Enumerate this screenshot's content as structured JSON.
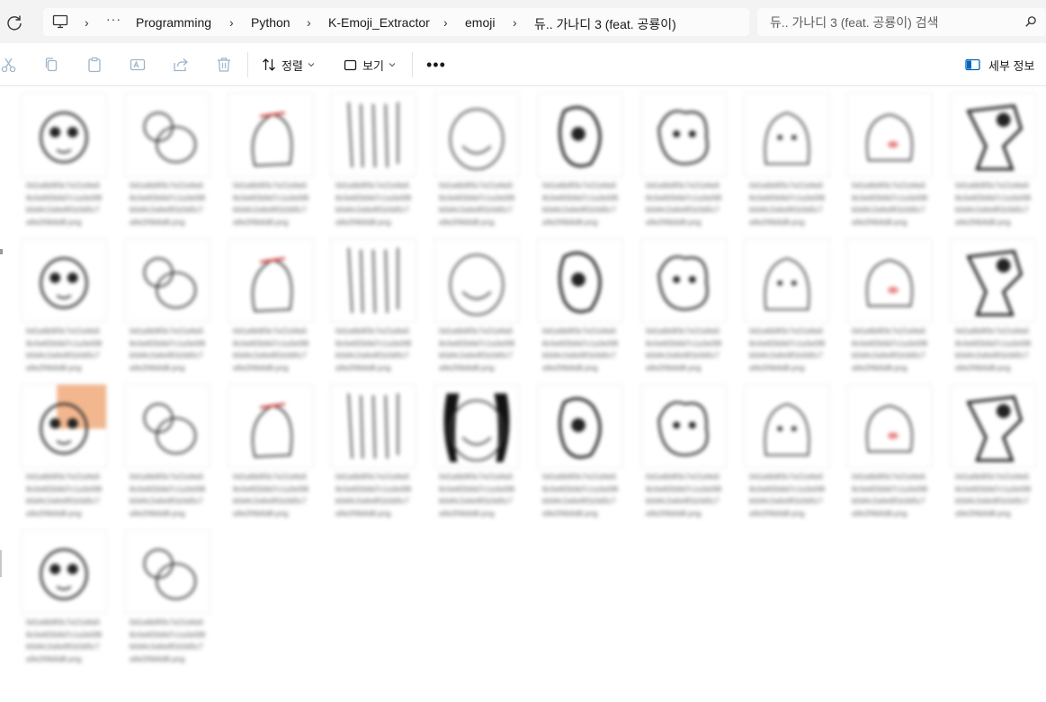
{
  "address": {
    "crumbs": [
      "Programming",
      "Python",
      "K-Emoji_Extractor",
      "emoji",
      "듀.. 가나디 3 (feat. 공룡이)"
    ]
  },
  "search": {
    "placeholder": "듀.. 가나디 3 (feat. 공룡이) 검색"
  },
  "toolbar": {
    "sort_label": "정렬",
    "view_label": "보기",
    "more_label": "•••",
    "details_label": "세부 정보"
  },
  "icons": {
    "refresh": "refresh-icon",
    "this_pc": "computer-icon",
    "overflow": "ellipsis-icon",
    "search": "search-icon",
    "cut": "scissors-icon",
    "copy": "copy-icon",
    "paste": "clipboard-icon",
    "rename": "rename-icon",
    "share": "share-icon",
    "delete": "trash-icon",
    "sort": "sort-arrows-icon",
    "view": "square-icon",
    "details": "details-pane-icon"
  },
  "colors": {
    "address_bg": "#f3f3f3",
    "accent": "#0067c0",
    "thumb_highlight": "#f2b78f"
  },
  "files": [
    {
      "name": "0d1a6b9f3c7e21d4a58c0e6f2b9d7c1a3e5f8b0d4c2a6e9f1b3d5c7a9e2f4b6d8.png"
    },
    {
      "name": "0d1a6b9f3c7e21d4a58c0e6f2b9d7c1a3e5f8b0d4c2a6e9f1b3d5c7a9e2f4b6d8.png"
    },
    {
      "name": "0d1a6b9f3c7e21d4a58c0e6f2b9d7c1a3e5f8b0d4c2a6e9f1b3d5c7a9e2f4b6d8.png"
    },
    {
      "name": "0d1a6b9f3c7e21d4a58c0e6f2b9d7c1a3e5f8b0d4c2a6e9f1b3d5c7a9e2f4b6d8.png"
    },
    {
      "name": "0d1a6b9f3c7e21d4a58c0e6f2b9d7c1a3e5f8b0d4c2a6e9f1b3d5c7a9e2f4b6d8.png"
    },
    {
      "name": "0d1a6b9f3c7e21d4a58c0e6f2b9d7c1a3e5f8b0d4c2a6e9f1b3d5c7a9e2f4b6d8.png"
    },
    {
      "name": "0d1a6b9f3c7e21d4a58c0e6f2b9d7c1a3e5f8b0d4c2a6e9f1b3d5c7a9e2f4b6d8.png"
    },
    {
      "name": "0d1a6b9f3c7e21d4a58c0e6f2b9d7c1a3e5f8b0d4c2a6e9f1b3d5c7a9e2f4b6d8.png"
    },
    {
      "name": "0d1a6b9f3c7e21d4a58c0e6f2b9d7c1a3e5f8b0d4c2a6e9f1b3d5c7a9e2f4b6d8.png"
    },
    {
      "name": "0d1a6b9f3c7e21d4a58c0e6f2b9d7c1a3e5f8b0d4c2a6e9f1b3d5c7a9e2f4b6d8.png"
    },
    {
      "name": "0d1a6b9f3c7e21d4a58c0e6f2b9d7c1a3e5f8b0d4c2a6e9f1b3d5c7a9e2f4b6d8.png"
    },
    {
      "name": "0d1a6b9f3c7e21d4a58c0e6f2b9d7c1a3e5f8b0d4c2a6e9f1b3d5c7a9e2f4b6d8.png"
    },
    {
      "name": "0d1a6b9f3c7e21d4a58c0e6f2b9d7c1a3e5f8b0d4c2a6e9f1b3d5c7a9e2f4b6d8.png"
    },
    {
      "name": "0d1a6b9f3c7e21d4a58c0e6f2b9d7c1a3e5f8b0d4c2a6e9f1b3d5c7a9e2f4b6d8.png"
    },
    {
      "name": "0d1a6b9f3c7e21d4a58c0e6f2b9d7c1a3e5f8b0d4c2a6e9f1b3d5c7a9e2f4b6d8.png"
    },
    {
      "name": "0d1a6b9f3c7e21d4a58c0e6f2b9d7c1a3e5f8b0d4c2a6e9f1b3d5c7a9e2f4b6d8.png"
    },
    {
      "name": "0d1a6b9f3c7e21d4a58c0e6f2b9d7c1a3e5f8b0d4c2a6e9f1b3d5c7a9e2f4b6d8.png"
    },
    {
      "name": "0d1a6b9f3c7e21d4a58c0e6f2b9d7c1a3e5f8b0d4c2a6e9f1b3d5c7a9e2f4b6d8.png"
    },
    {
      "name": "0d1a6b9f3c7e21d4a58c0e6f2b9d7c1a3e5f8b0d4c2a6e9f1b3d5c7a9e2f4b6d8.png"
    },
    {
      "name": "0d1a6b9f3c7e21d4a58c0e6f2b9d7c1a3e5f8b0d4c2a6e9f1b3d5c7a9e2f4b6d8.png"
    },
    {
      "name": "0d1a6b9f3c7e21d4a58c0e6f2b9d7c1a3e5f8b0d4c2a6e9f1b3d5c7a9e2f4b6d8.png"
    },
    {
      "name": "0d1a6b9f3c7e21d4a58c0e6f2b9d7c1a3e5f8b0d4c2a6e9f1b3d5c7a9e2f4b6d8.png"
    },
    {
      "name": "0d1a6b9f3c7e21d4a58c0e6f2b9d7c1a3e5f8b0d4c2a6e9f1b3d5c7a9e2f4b6d8.png"
    },
    {
      "name": "0d1a6b9f3c7e21d4a58c0e6f2b9d7c1a3e5f8b0d4c2a6e9f1b3d5c7a9e2f4b6d8.png"
    },
    {
      "name": "0d1a6b9f3c7e21d4a58c0e6f2b9d7c1a3e5f8b0d4c2a6e9f1b3d5c7a9e2f4b6d8.png"
    },
    {
      "name": "0d1a6b9f3c7e21d4a58c0e6f2b9d7c1a3e5f8b0d4c2a6e9f1b3d5c7a9e2f4b6d8.png"
    },
    {
      "name": "0d1a6b9f3c7e21d4a58c0e6f2b9d7c1a3e5f8b0d4c2a6e9f1b3d5c7a9e2f4b6d8.png"
    },
    {
      "name": "0d1a6b9f3c7e21d4a58c0e6f2b9d7c1a3e5f8b0d4c2a6e9f1b3d5c7a9e2f4b6d8.png"
    },
    {
      "name": "0d1a6b9f3c7e21d4a58c0e6f2b9d7c1a3e5f8b0d4c2a6e9f1b3d5c7a9e2f4b6d8.png"
    },
    {
      "name": "0d1a6b9f3c7e21d4a58c0e6f2b9d7c1a3e5f8b0d4c2a6e9f1b3d5c7a9e2f4b6d8.png"
    },
    {
      "name": "0d1a6b9f3c7e21d4a58c0e6f2b9d7c1a3e5f8b0d4c2a6e9f1b3d5c7a9e2f4b6d8.png"
    },
    {
      "name": "0d1a6b9f3c7e21d4a58c0e6f2b9d7c1a3e5f8b0d4c2a6e9f1b3d5c7a9e2f4b6d8.png"
    }
  ]
}
